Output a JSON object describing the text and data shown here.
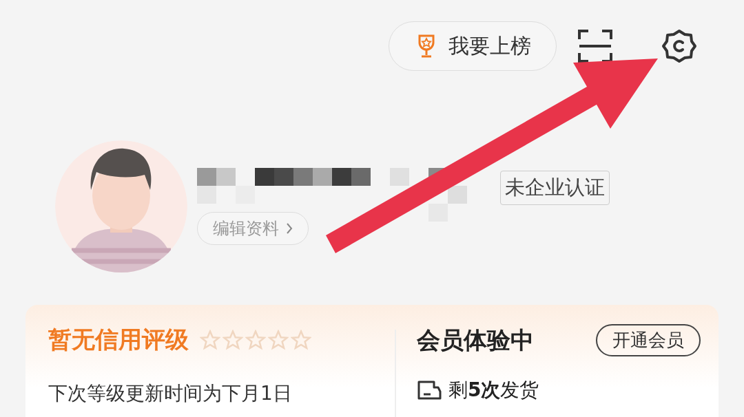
{
  "header": {
    "rank_button": "我要上榜"
  },
  "profile": {
    "enterprise_badge": "未企业认证",
    "edit_button": "编辑资料"
  },
  "credit": {
    "title": "暂无信用评级",
    "stars": 0,
    "note": "下次等级更新时间为下月1日"
  },
  "membership": {
    "title": "会员体验中",
    "button": "开通会员",
    "shipments": "剩**5次**发货"
  }
}
